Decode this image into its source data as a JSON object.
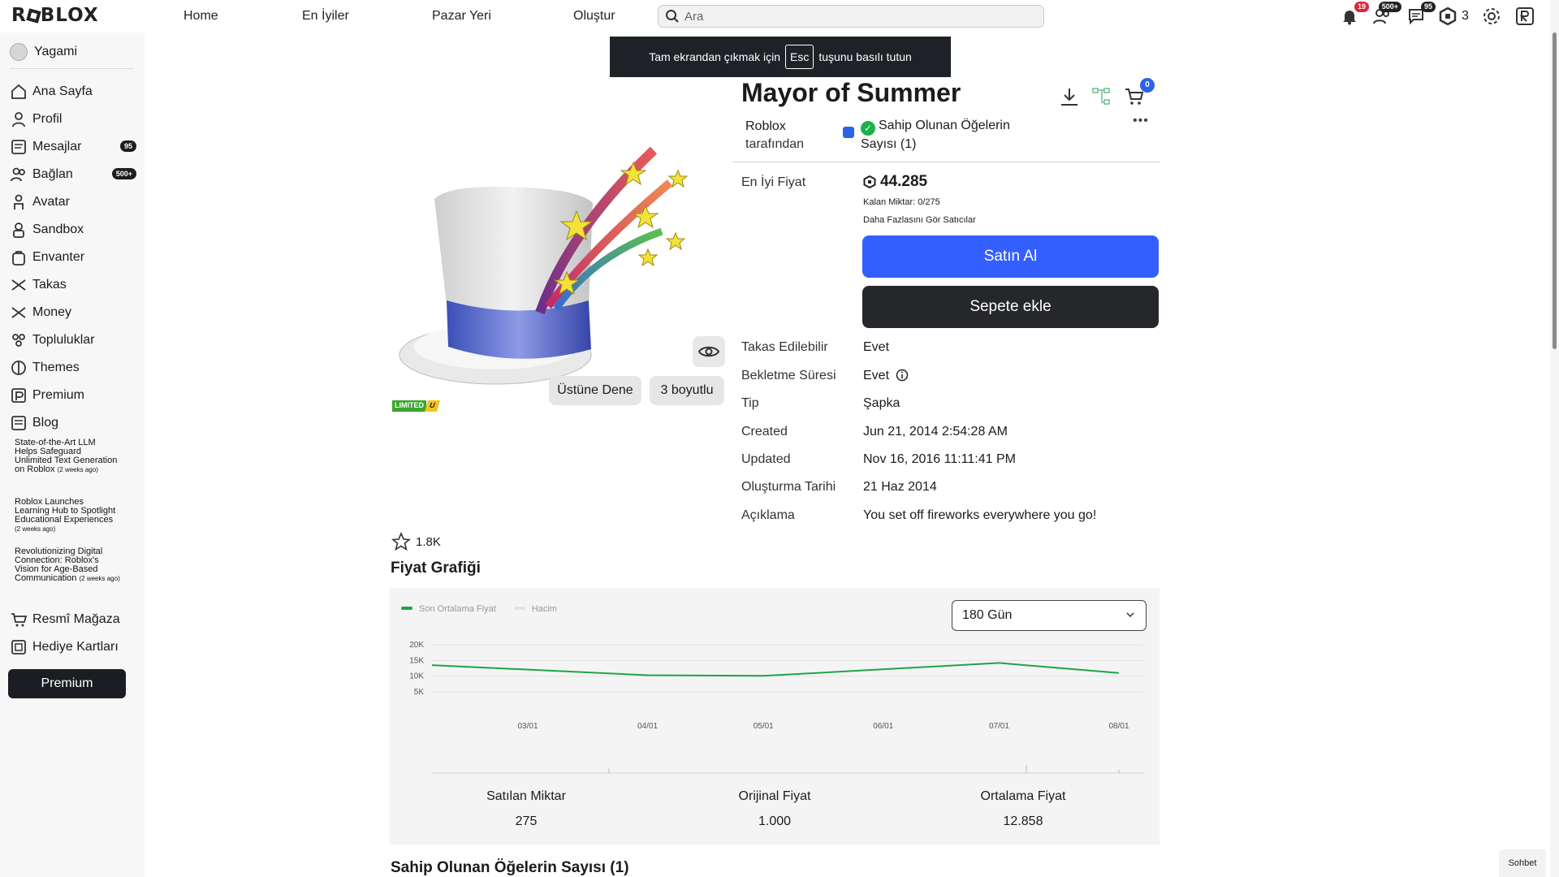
{
  "nav": {
    "logo": "R⬛BLOX",
    "links": [
      "Home",
      "En İyiler",
      "Pazar Yeri",
      "Oluştur"
    ],
    "search_placeholder": "Ara",
    "notif_badge": "19",
    "friends_badge": "500+",
    "messages_badge": "95",
    "robux": "3"
  },
  "sidebar": {
    "username": "Yagami",
    "items": [
      {
        "label": "Ana Sayfa",
        "icon": "home-icon"
      },
      {
        "label": "Profil",
        "icon": "profile-icon"
      },
      {
        "label": "Mesajlar",
        "icon": "messages-icon",
        "badge": "95"
      },
      {
        "label": "Bağlan",
        "icon": "connect-icon",
        "badge": "500+"
      },
      {
        "label": "Avatar",
        "icon": "avatar-icon"
      },
      {
        "label": "Sandbox",
        "icon": "sandbox-icon"
      },
      {
        "label": "Envanter",
        "icon": "inventory-icon"
      },
      {
        "label": "Takas",
        "icon": "trade-icon"
      },
      {
        "label": "Money",
        "icon": "money-icon"
      },
      {
        "label": "Topluluklar",
        "icon": "communities-icon"
      },
      {
        "label": "Themes",
        "icon": "themes-icon"
      },
      {
        "label": "Premium",
        "icon": "premium-icon"
      },
      {
        "label": "Blog",
        "icon": "blog-icon"
      }
    ],
    "blog_posts": [
      {
        "title": "State-of-the-Art LLM Helps Safeguard Unlimited Text Generation on Roblox",
        "ago": "(2 weeks ago)"
      },
      {
        "title": "Roblox Launches Learning Hub to Spotlight Educational Experiences",
        "ago": "(2 weeks ago)"
      },
      {
        "title": "Revolutionizing Digital Connection: Roblox's Vision for Age-Based Communication",
        "ago": "(2 weeks ago)"
      }
    ],
    "bottom_items": [
      {
        "label": "Resmî Mağaza",
        "icon": "shop-icon"
      },
      {
        "label": "Hediye Kartları",
        "icon": "gift-card-icon"
      }
    ],
    "premium_button": "Premium"
  },
  "toast": {
    "before": "Tam ekrandan çıkmak için",
    "key": "Esc",
    "after": "tuşunu basılı tutun"
  },
  "item": {
    "title": "Mayor of Summer",
    "creator_name": "Roblox",
    "creator_by": "tarafından",
    "owned_text": "Sahip Olunan Öğelerin Sayısı (1)",
    "cart_count": "0",
    "more": "•••",
    "try_on": "Üstüne Dene",
    "three_d": "3 boyutlu",
    "limited_label": "LIMITED",
    "limited_u": "U",
    "favorites": "1.8K",
    "best_price_label": "En İyi Fiyat",
    "best_price": "44.285",
    "remaining": "Kalan Miktar: 0/275",
    "more_sellers": "Daha Fazlasını Gör Satıcılar",
    "buy_button": "Satın Al",
    "add_to_cart_button": "Sepete ekle",
    "details": [
      {
        "key": "Takas Edilebilir",
        "value": "Evet"
      },
      {
        "key": "Bekletme Süresi",
        "value": "Evet"
      },
      {
        "key": "Tip",
        "value": "Şapka"
      },
      {
        "key": "Created",
        "value": "Jun 21, 2014 2:54:28 AM"
      },
      {
        "key": "Updated",
        "value": "Nov 16, 2016 11:11:41 PM"
      },
      {
        "key": "Oluşturma Tarihi",
        "value": "21 Haz 2014"
      },
      {
        "key": "Açıklama",
        "value": "You set off fireworks everywhere you go!"
      }
    ]
  },
  "price_chart_section": {
    "title": "Fiyat Grafiği",
    "range_option": "180 Gün",
    "stats": [
      {
        "label": "Satılan Miktar",
        "value": "275"
      },
      {
        "label": "Orijinal Fiyat",
        "value": "1.000"
      },
      {
        "label": "Ortalama Fiyat",
        "value": "12.858"
      }
    ]
  },
  "owned_section_title": "Sahip Olunan Öğelerin Sayısı (1)",
  "chat_button": "Sohbet",
  "colors": {
    "buy": "#335fff",
    "cart": "#25272b",
    "line": "#1ea446",
    "verified": "#2b63e8",
    "badge_red": "#e0263a"
  },
  "chart_data": {
    "type": "line",
    "title": "",
    "series": [
      {
        "name": "Son Ortalama Fiyat",
        "color": "#1ea446",
        "x": [
          "2024-02-01",
          "2024-04-01",
          "2024-05-01",
          "2024-07-01",
          "2024-08-01"
        ],
        "values": [
          13500,
          10300,
          10100,
          14200,
          11000
        ]
      },
      {
        "name": "Hacim",
        "color": "#e2e2e2",
        "values": []
      }
    ],
    "x_ticks": [
      "03/01",
      "04/01",
      "05/01",
      "06/01",
      "07/01",
      "08/01"
    ],
    "y_ticks": [
      "20K",
      "15K",
      "10K",
      "5K"
    ],
    "ylim": [
      5000,
      20000
    ],
    "grid": true,
    "legend": "top-left"
  }
}
